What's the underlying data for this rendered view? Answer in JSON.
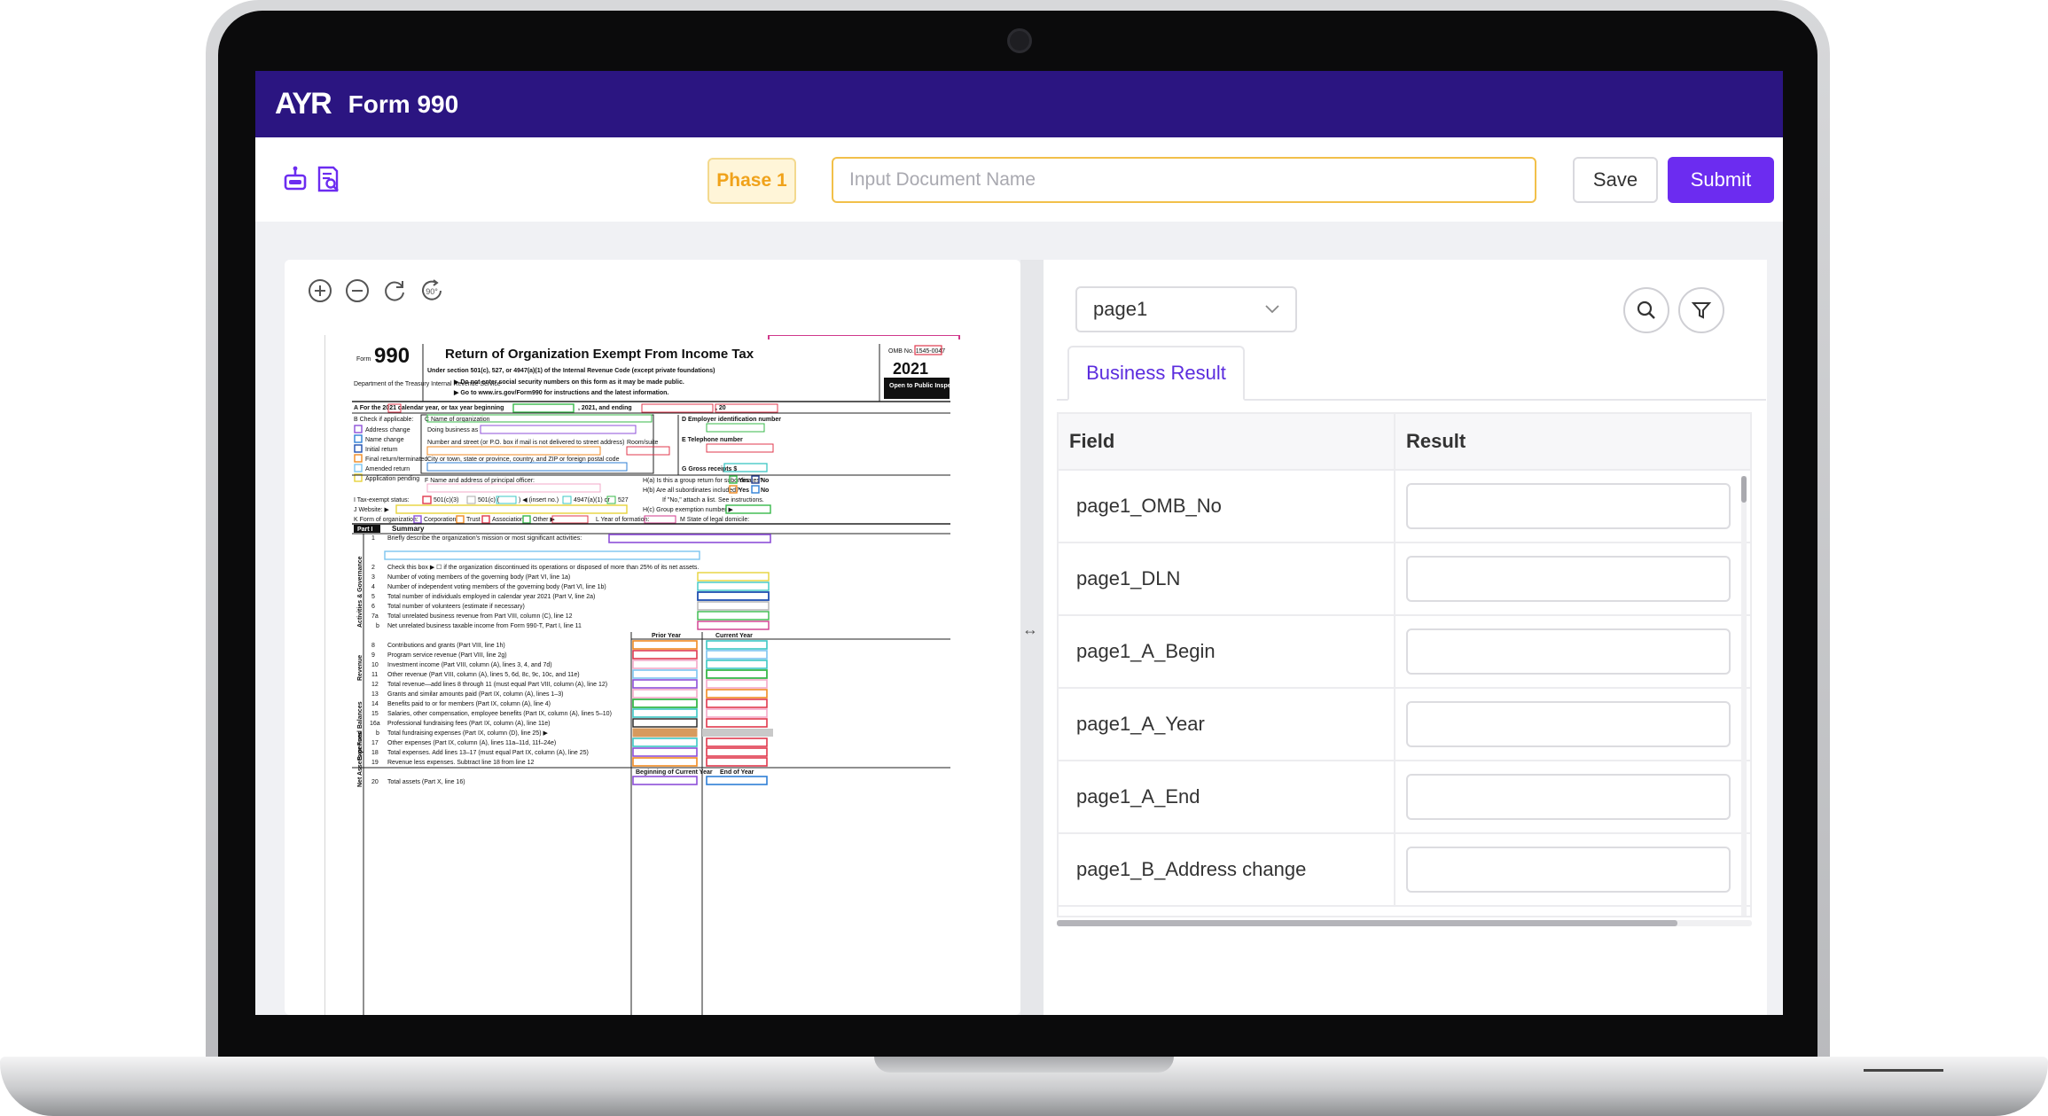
{
  "app": {
    "logo": "AYR",
    "title": "Form 990"
  },
  "toolbar": {
    "phase_label": "Phase 1",
    "document_name_placeholder": "Input Document Name",
    "document_name_value": "",
    "save_label": "Save",
    "submit_label": "Submit",
    "icons": [
      "robot-icon",
      "document-search-icon"
    ]
  },
  "viewer": {
    "zoom_controls": [
      "zoom-in-icon",
      "zoom-out-icon",
      "refresh-icon",
      "rotate-90-icon"
    ],
    "rotate_label": "90°",
    "form": {
      "form_label": "Form",
      "form_number": "990",
      "title": "Return of Organization Exempt From Income Tax",
      "subtitle": "Under section 501(c), 527, or 4947(a)(1) of the Internal Revenue Code (except private foundations)",
      "notice_1": "▶ Do not enter social security numbers on this form as it may be made public.",
      "notice_2": "▶ Go to www.irs.gov/Form990 for instructions and the latest information.",
      "dept": "Department of the Treasury Internal Revenue Service",
      "omb": "OMB No. 1545-0047",
      "year": "2021",
      "open_to_public": "Open to Public Inspection",
      "line_a": "A   For the 2021 calendar year, or tax year beginning",
      "line_a_mid": ", 2021, and ending",
      "line_a_end": ", 20",
      "check_if": "B   Check if applicable:",
      "b_items": [
        "Address change",
        "Name change",
        "Initial return",
        "Final return/terminated",
        "Amended return",
        "Application pending"
      ],
      "c_name": "C Name of organization",
      "dba": "Doing business as",
      "street": "Number and street (or P.O. box if mail is not delivered to street address)",
      "room": "Room/suite",
      "city": "City or town, state or province, country, and ZIP or foreign postal code",
      "d_ein": "D Employer identification number",
      "e_phone": "E Telephone number",
      "g_gross": "G Gross receipts $",
      "f_principal": "F Name and address of principal officer:",
      "h_a": "H(a) Is this a group return for subordinates?",
      "h_b": "H(b) Are all subordinates included?",
      "h_b_note": "If \"No,\" attach a list. See instructions.",
      "h_c": "H(c) Group exemption number ▶",
      "yes": "Yes",
      "no": "No",
      "line_i": "I   Tax-exempt status:",
      "i_options": [
        "501(c)(3)",
        "501(c) (",
        ") ◀ (insert no.)",
        "4947(a)(1) or",
        "527"
      ],
      "line_j": "J   Website: ▶",
      "line_k": "K   Form of organization:",
      "k_options": [
        "Corporation",
        "Trust",
        "Association",
        "Other ▶"
      ],
      "line_l": "L Year of formation:",
      "line_m": "M State of legal domicile:",
      "part_label": "Part I",
      "part_title": "Summary",
      "side_activities": "Activities & Governance",
      "side_revenue": "Revenue",
      "side_expenses": "Expenses",
      "side_net": "Net Assets or Fund Balances",
      "col_prior": "Prior Year",
      "col_current": "Current Year",
      "col_begin": "Beginning of Current Year",
      "col_end": "End of Year",
      "lines": [
        {
          "num": "1",
          "text": "Briefly describe the organization's mission or most significant activities:"
        },
        {
          "num": "2",
          "text": "Check this box ▶ ☐ if the organization discontinued its operations or disposed of more than 25% of its net assets."
        },
        {
          "num": "3",
          "text": "Number of voting members of the governing body (Part VI, line 1a)"
        },
        {
          "num": "4",
          "text": "Number of independent voting members of the governing body (Part VI, line 1b)"
        },
        {
          "num": "5",
          "text": "Total number of individuals employed in calendar year 2021 (Part V, line 2a)"
        },
        {
          "num": "6",
          "text": "Total number of volunteers (estimate if necessary)"
        },
        {
          "num": "7a",
          "text": "Total unrelated business revenue from Part VIII, column (C), line 12"
        },
        {
          "num": "b",
          "text": "Net unrelated business taxable income from Form 990-T, Part I, line 11"
        },
        {
          "num": "8",
          "text": "Contributions and grants (Part VIII, line 1h)"
        },
        {
          "num": "9",
          "text": "Program service revenue (Part VIII, line 2g)"
        },
        {
          "num": "10",
          "text": "Investment income (Part VIII, column (A), lines 3, 4, and 7d)"
        },
        {
          "num": "11",
          "text": "Other revenue (Part VIII, column (A), lines 5, 6d, 8c, 9c, 10c, and 11e)"
        },
        {
          "num": "12",
          "text": "Total revenue—add lines 8 through 11 (must equal Part VIII, column (A), line 12)"
        },
        {
          "num": "13",
          "text": "Grants and similar amounts paid (Part IX, column (A), lines 1–3)"
        },
        {
          "num": "14",
          "text": "Benefits paid to or for members (Part IX, column (A), line 4)"
        },
        {
          "num": "15",
          "text": "Salaries, other compensation, employee benefits (Part IX, column (A), lines 5–10)"
        },
        {
          "num": "16a",
          "text": "Professional fundraising fees (Part IX, column (A), line 11e)"
        },
        {
          "num": "b",
          "text": "Total fundraising expenses (Part IX, column (D), line 25) ▶"
        },
        {
          "num": "17",
          "text": "Other expenses (Part IX, column (A), lines 11a–11d, 11f–24e)"
        },
        {
          "num": "18",
          "text": "Total expenses. Add lines 13–17 (must equal Part IX, column (A), line 25)"
        },
        {
          "num": "19",
          "text": "Revenue less expenses. Subtract line 18 from line 12"
        },
        {
          "num": "20",
          "text": "Total assets (Part X, line 16)"
        }
      ]
    }
  },
  "results": {
    "page_select_value": "page1",
    "tab_label": "Business Result",
    "col_field": "Field",
    "col_result": "Result",
    "rows": [
      {
        "field": "page1_OMB_No",
        "value": ""
      },
      {
        "field": "page1_DLN",
        "value": ""
      },
      {
        "field": "page1_A_Begin",
        "value": ""
      },
      {
        "field": "page1_A_Year",
        "value": ""
      },
      {
        "field": "page1_A_End",
        "value": ""
      },
      {
        "field": "page1_B_Address change",
        "value": ""
      }
    ]
  },
  "colors": {
    "header_bg": "#2b1581",
    "accent": "#6c2cf0",
    "phase_text": "#f0a21a",
    "input_border": "#f2c04a"
  }
}
